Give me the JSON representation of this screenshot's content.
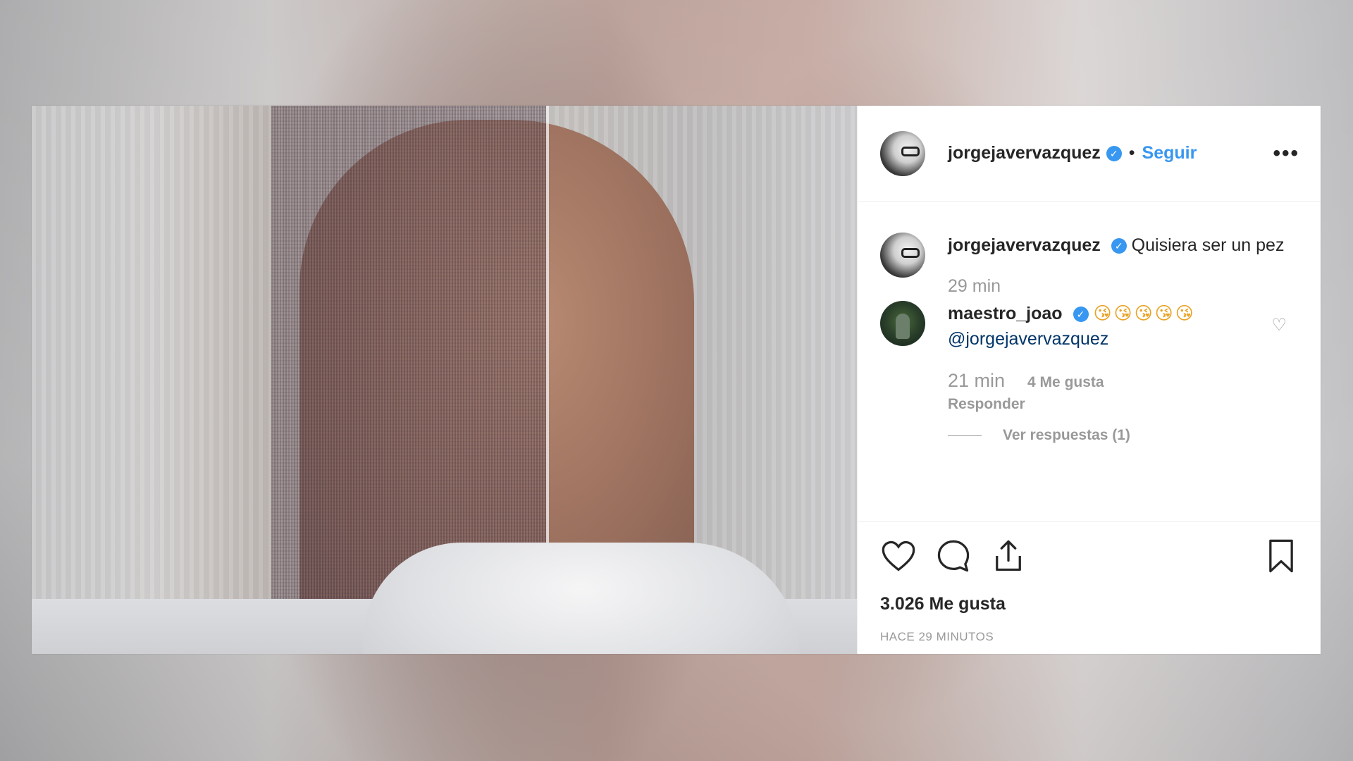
{
  "header": {
    "username": "jorgejavervazquez",
    "separator": "•",
    "follow_label": "Seguir",
    "more_label": "•••"
  },
  "caption": {
    "username": "jorgejavervazquez",
    "text": "Quisiera ser un pez",
    "time": "29 min"
  },
  "comment": {
    "username": "maestro_joao",
    "emojis": "😘😘😘😘😘",
    "mention": "@jorgejavervazquez",
    "time": "21 min",
    "likes": "4 Me gusta",
    "reply_label": "Responder",
    "view_replies": "Ver respuestas (1)"
  },
  "actions": {
    "like_count": "3.026 Me gusta",
    "timestamp": "HACE 29 MINUTOS"
  },
  "icons": {
    "verified": "verified-badge-icon",
    "like": "heart-icon",
    "comment": "comment-bubble-icon",
    "share": "share-icon",
    "save": "bookmark-icon",
    "more": "ellipsis-icon"
  },
  "colors": {
    "link_blue": "#3897f0",
    "mention": "#003569",
    "text": "#262626",
    "muted": "#999999"
  }
}
